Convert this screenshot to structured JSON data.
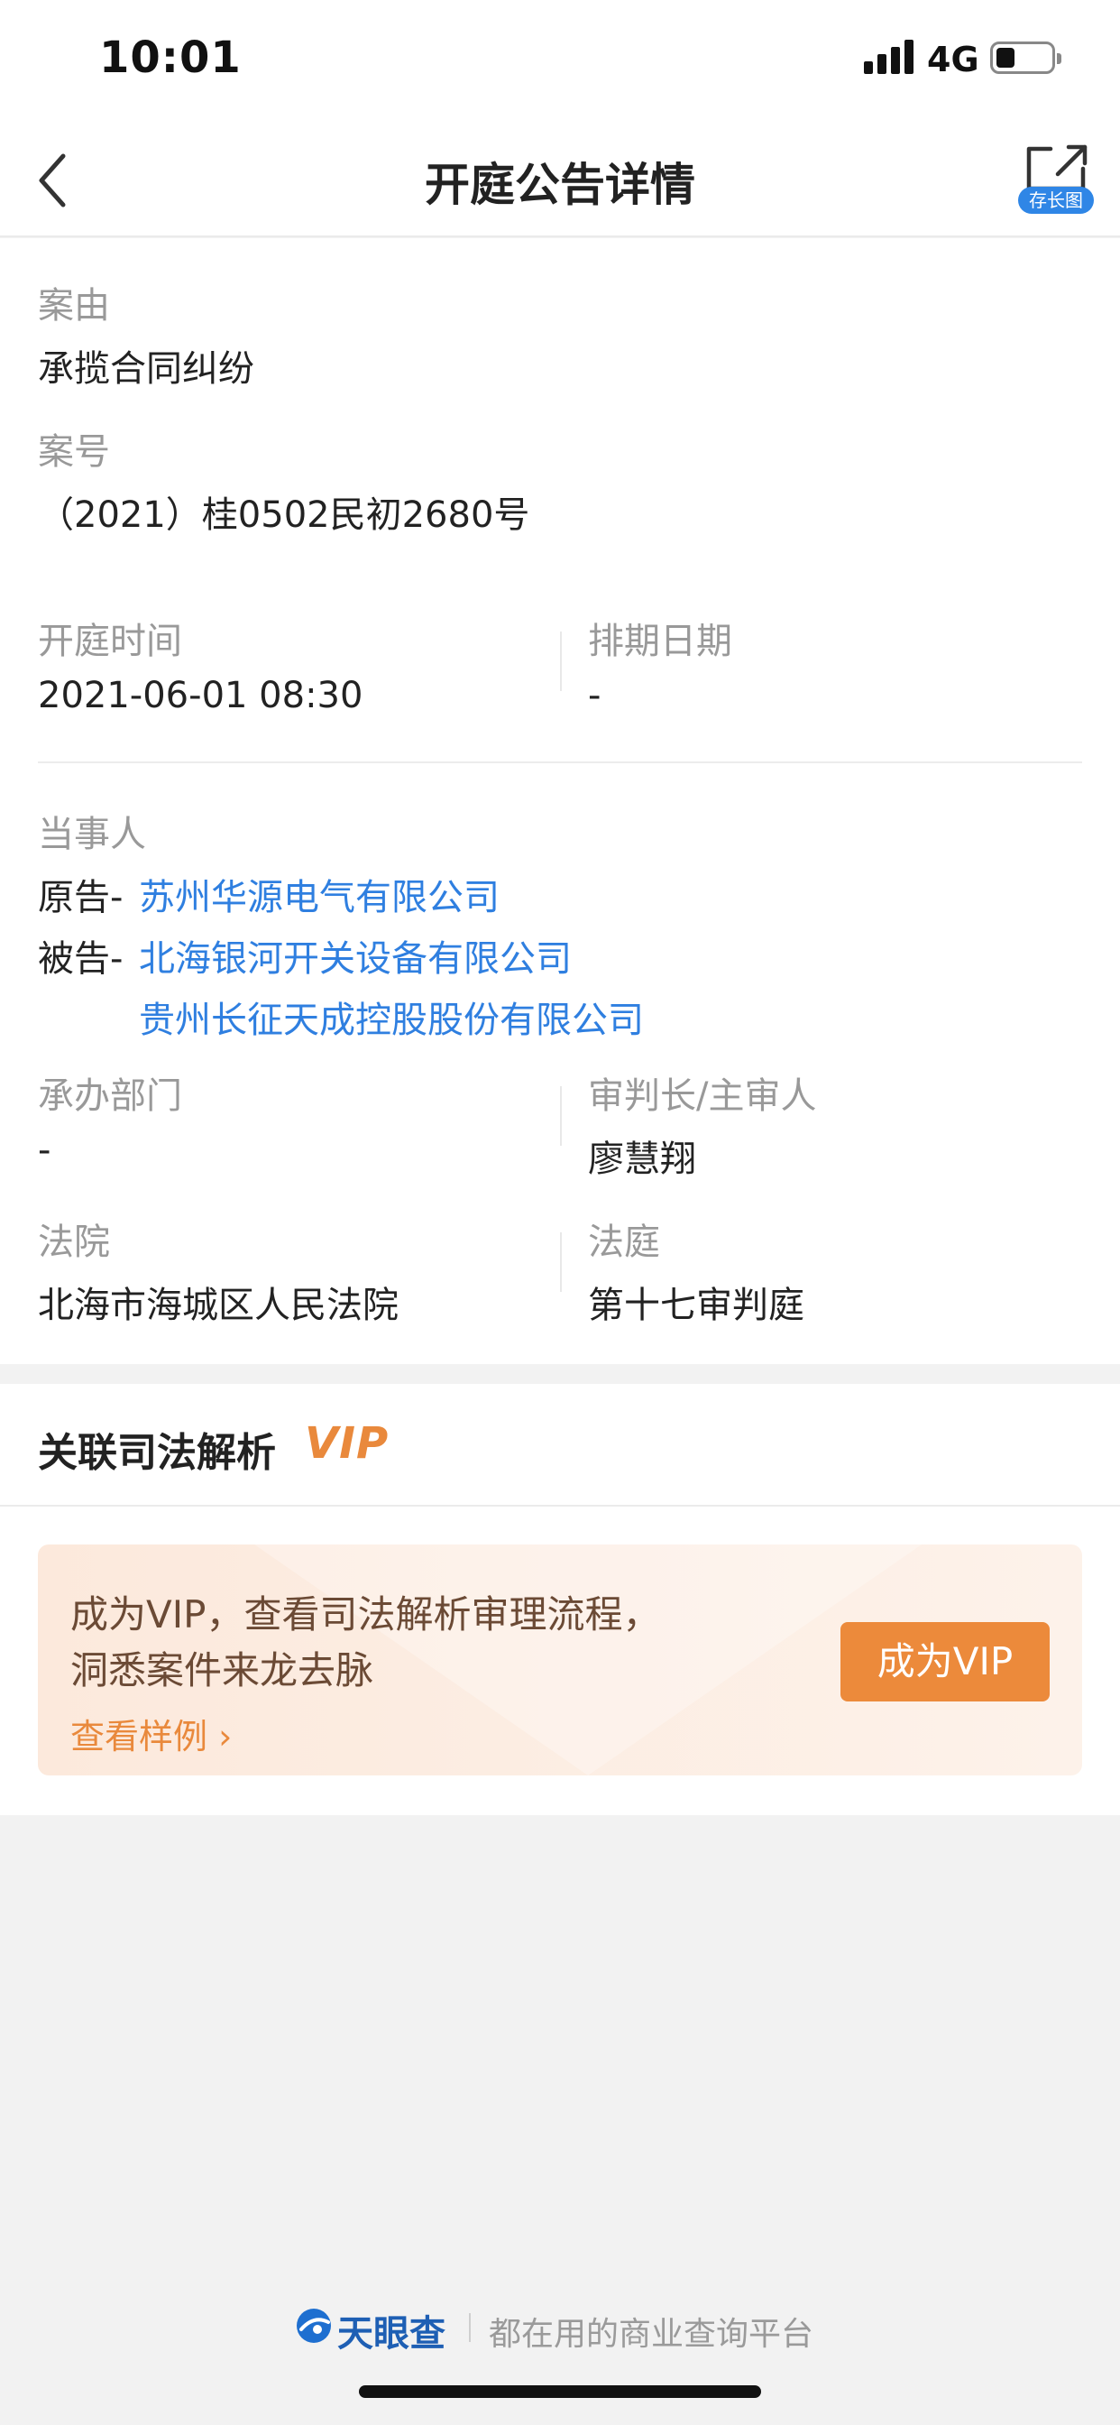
{
  "status": {
    "time": "10:01",
    "network": "4G"
  },
  "nav": {
    "title": "开庭公告详情",
    "share_badge": "存长图"
  },
  "case": {
    "cause_label": "案由",
    "cause_value": "承揽合同纠纷",
    "number_label": "案号",
    "number_value": "（2021）桂0502民初2680号",
    "hearing_time_label": "开庭时间",
    "hearing_time_value": "2021-06-01 08:30",
    "schedule_date_label": "排期日期",
    "schedule_date_value": "-",
    "parties_label": "当事人",
    "plaintiff_prefix": "原告-",
    "plaintiffs": [
      "苏州华源电气有限公司"
    ],
    "defendant_prefix": "被告-",
    "defendants": [
      "北海银河开关设备有限公司",
      "贵州长征天成控股股份有限公司"
    ],
    "department_label": "承办部门",
    "department_value": "-",
    "judge_label": "审判长/主审人",
    "judge_value": "廖慧翔",
    "court_label": "法院",
    "court_value": "北海市海城区人民法院",
    "courtroom_label": "法庭",
    "courtroom_value": "第十七审判庭"
  },
  "related": {
    "title": "关联司法解析",
    "vip_logo": "VIP",
    "promo_line1": "成为VIP，查看司法解析审理流程，",
    "promo_line2": "洞悉案件来龙去脉",
    "sample_link": "查看样例 ›",
    "vip_button": "成为VIP"
  },
  "footer": {
    "brand": "天眼查",
    "slogan": "都在用的商业查询平台"
  },
  "colors": {
    "link": "#2f7fe0",
    "vip_orange": "#ec8a3b",
    "badge_blue": "#2f86e6",
    "brand_blue": "#1e5fb4"
  }
}
